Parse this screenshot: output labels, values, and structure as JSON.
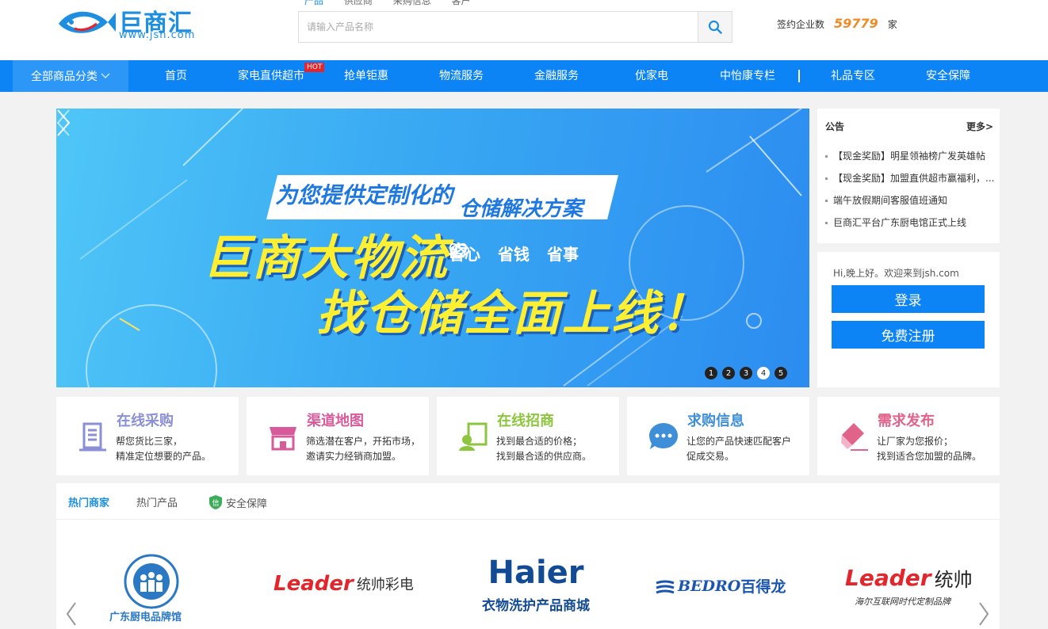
{
  "header": {
    "logo_text": "巨商汇",
    "logo_url": "www.jsh.com",
    "search_tabs": [
      "产品",
      "供应商",
      "采购信息",
      "客户"
    ],
    "search_placeholder": "请输入产品名称",
    "signed_label": "签约企业数",
    "signed_count": "59779",
    "signed_unit": "家"
  },
  "nav": {
    "all_label": "全部商品分类",
    "items": [
      "首页",
      "家电直供超市",
      "抢单钜惠",
      "物流服务",
      "金融服务",
      "优家电",
      "中怡康专栏",
      "礼品专区",
      "安全保障"
    ],
    "hot_badge": "HOT"
  },
  "banner": {
    "title_part1": "为您提供定制化的",
    "title_part2": "仓储解决方案",
    "main": "巨商大物流",
    "sub": "找仓储全面上线！",
    "tags": [
      "省心",
      "省钱",
      "省事"
    ],
    "dots": [
      "1",
      "2",
      "3",
      "4",
      "5"
    ],
    "active_dot": 4
  },
  "notice": {
    "title": "公告",
    "more": "更多>",
    "items": [
      "【现金奖励】明星领袖榜广发英雄帖",
      "【现金奖励】加盟直供超市赢福利，...",
      "端午放假期间客服值班通知",
      "巨商汇平台广东厨电馆正式上线"
    ]
  },
  "login": {
    "greeting": "Hi,晚上好。欢迎来到jsh.com",
    "login_label": "登录",
    "register_label": "免费注册"
  },
  "cards": [
    {
      "title": "在线采购",
      "line1": "帮您货比三家，",
      "line2": "精准定位想要的产品。",
      "color": "#8a8fd6"
    },
    {
      "title": "渠道地图",
      "line1": "筛选潜在客户，开拓市场，",
      "line2": "邀请实力经销商加盟。",
      "color": "#d75b9a"
    },
    {
      "title": "在线招商",
      "line1": "找到最合适的价格；",
      "line2": "找到最合适的供应商。",
      "color": "#8cc63e"
    },
    {
      "title": "求购信息",
      "line1": "让您的产品快速匹配客户",
      "line2": "促成交易。",
      "color": "#3e8fd8"
    },
    {
      "title": "需求发布",
      "line1": "让厂家为您报价；",
      "line2": "找到适合您加盟的品牌。",
      "color": "#e0638a"
    }
  ],
  "brands": {
    "tabs": [
      "热门商家",
      "热门产品",
      "安全保障"
    ],
    "shield_char": "信",
    "items": [
      {
        "name": "广东厨电品牌馆"
      },
      {
        "name": "Leader",
        "tagline": "统帅彩电"
      },
      {
        "name": "Haier",
        "tagline": "衣物洗护产品商城"
      },
      {
        "name": "BEDRO",
        "tagline": "百得龙"
      },
      {
        "name": "Leader",
        "tagline": "统帅",
        "slogan": "海尔互联网时代定制品牌"
      }
    ]
  }
}
